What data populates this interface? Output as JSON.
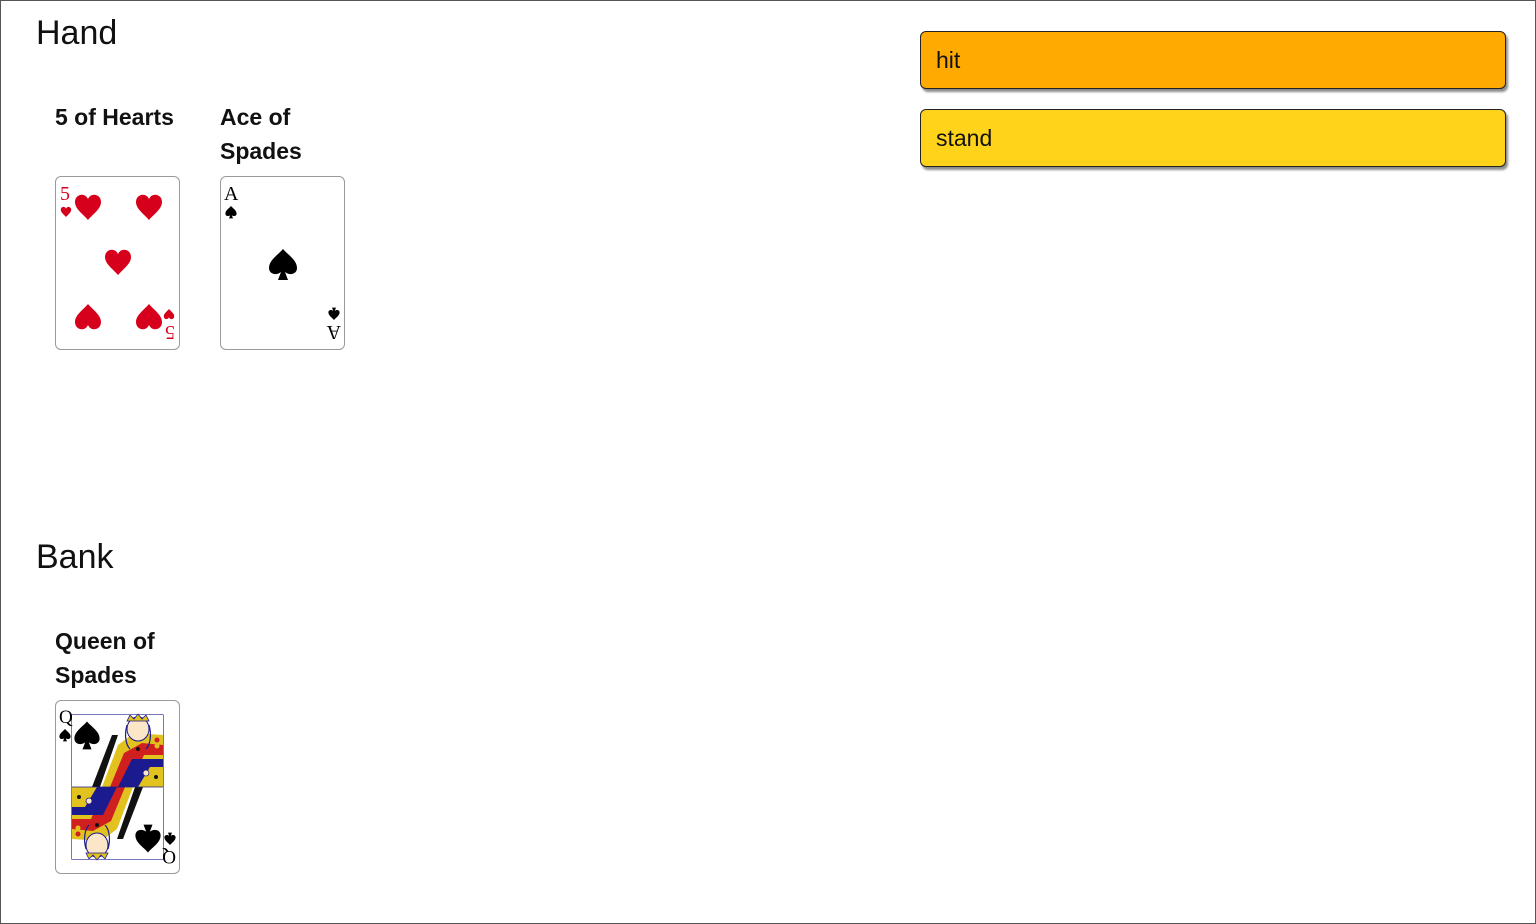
{
  "hand": {
    "title": "Hand",
    "cards": [
      {
        "label": "5 of Hearts",
        "rank": "5",
        "suit": "hearts"
      },
      {
        "label": "Ace of Spades",
        "rank": "A",
        "suit": "spades"
      }
    ]
  },
  "bank": {
    "title": "Bank",
    "cards": [
      {
        "label": "Queen of Spades",
        "rank": "Q",
        "suit": "spades"
      }
    ]
  },
  "actions": {
    "hit_label": "hit",
    "stand_label": "stand"
  },
  "colors": {
    "hit": "#ffaa00",
    "stand": "#ffd31a",
    "hearts": "#d6001c",
    "spades": "#000000"
  }
}
